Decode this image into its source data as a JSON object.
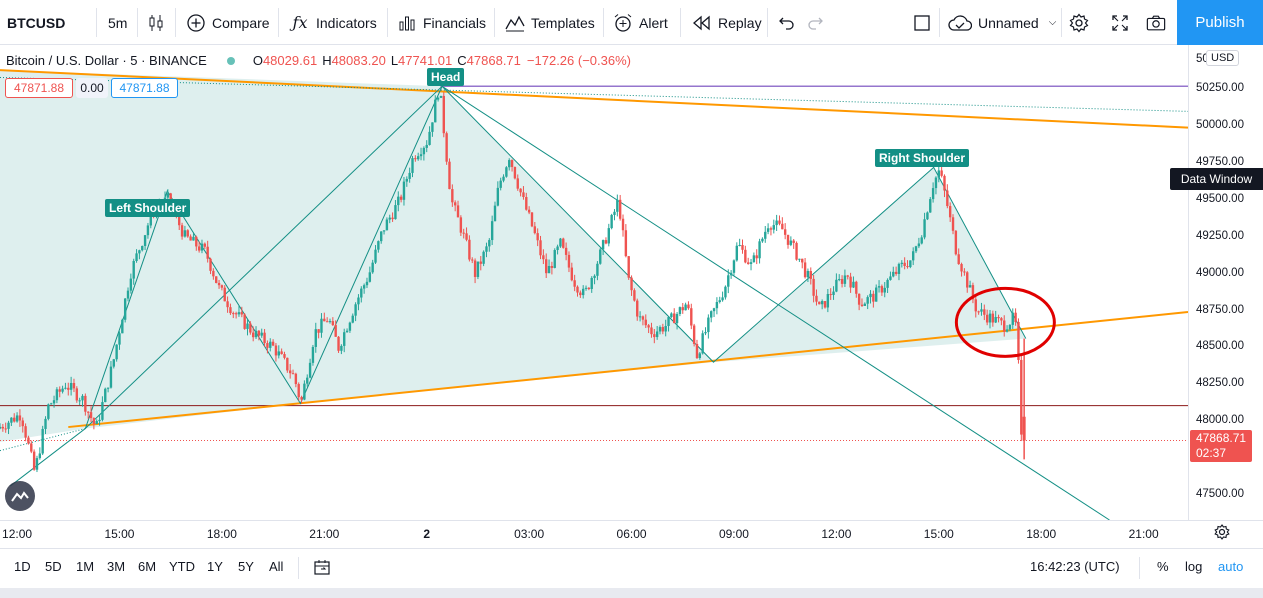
{
  "toolbar": {
    "symbol": "BTCUSD",
    "interval": "5m",
    "compare": "Compare",
    "indicators": "Indicators",
    "financials": "Financials",
    "templates": "Templates",
    "alert": "Alert",
    "replay": "Replay",
    "layout_name": "Unnamed",
    "publish": "Publish"
  },
  "legend": {
    "symbol_title": "Bitcoin / U.S. Dollar · 5 · BINANCE",
    "o_label": "O",
    "open": "48029.61",
    "h_label": "H",
    "high": "48083.20",
    "l_label": "L",
    "low": "47741.01",
    "c_label": "C",
    "close": "47868.71",
    "change": "−172.26 (−0.36%)"
  },
  "order_boxes": {
    "bid": "47871.88",
    "spread": "0.00",
    "ask": "47871.88"
  },
  "pattern_labels": {
    "left_shoulder": "Left Shoulder",
    "head": "Head",
    "right_shoulder": "Right Shoulder"
  },
  "price_axis": {
    "currency": "USD",
    "top_cut": "50...00",
    "data_window": "Data Window",
    "last_price": "47868.71",
    "countdown": "02:37"
  },
  "bottom_bar": {
    "ranges": [
      "1D",
      "5D",
      "1M",
      "3M",
      "6M",
      "YTD",
      "1Y",
      "5Y",
      "All"
    ],
    "clock": "16:42:23 (UTC)",
    "percent": "%",
    "log": "log",
    "auto": "auto"
  },
  "colors": {
    "up": "#26a69a",
    "down": "#ef5350",
    "pattern": "#138f85",
    "trendline": "#ff9800",
    "accent": "#2196f3",
    "highlight_circle": "#e00000"
  },
  "chart_data": {
    "type": "candlestick",
    "symbol": "BTCUSD",
    "interval": "5",
    "exchange": "BINANCE",
    "y_ticks": [
      50250,
      50000,
      49750,
      49500,
      49250,
      49000,
      48750,
      48500,
      48250,
      48000,
      47500
    ],
    "y_tick_labels": [
      "50250.00",
      "50000.00",
      "49750.00",
      "49500.00",
      "49250.00",
      "49000.00",
      "48750.00",
      "48500.00",
      "48250.00",
      "48000.00",
      "47500.00"
    ],
    "ylim": [
      47330,
      50550
    ],
    "x_tick_labels": [
      "12:00",
      "15:00",
      "18:00",
      "21:00",
      "2",
      "03:00",
      "06:00",
      "09:00",
      "12:00",
      "15:00",
      "18:00",
      "21:00"
    ],
    "x_ticks_hours": [
      12,
      15,
      18,
      21,
      24,
      27,
      30,
      33,
      36,
      39,
      42,
      45
    ],
    "xlim_hours": [
      11.5,
      46.3
    ],
    "price_path": [
      [
        11.5,
        47950
      ],
      [
        12.2,
        48050
      ],
      [
        12.6,
        47650
      ],
      [
        13.0,
        48100
      ],
      [
        13.5,
        48250
      ],
      [
        14.0,
        48150
      ],
      [
        14.4,
        47950
      ],
      [
        14.9,
        48400
      ],
      [
        15.4,
        49000
      ],
      [
        16.1,
        49450
      ],
      [
        16.5,
        49500
      ],
      [
        17.0,
        49250
      ],
      [
        17.6,
        49150
      ],
      [
        18.0,
        48900
      ],
      [
        18.4,
        48750
      ],
      [
        19.0,
        48600
      ],
      [
        19.6,
        48500
      ],
      [
        20.2,
        48300
      ],
      [
        20.4,
        48120
      ],
      [
        20.8,
        48600
      ],
      [
        21.2,
        48700
      ],
      [
        21.5,
        48500
      ],
      [
        22.0,
        48800
      ],
      [
        22.4,
        49000
      ],
      [
        22.8,
        49300
      ],
      [
        23.3,
        49500
      ],
      [
        23.7,
        49800
      ],
      [
        24.1,
        49900
      ],
      [
        24.45,
        50270
      ],
      [
        24.8,
        49500
      ],
      [
        25.1,
        49300
      ],
      [
        25.5,
        49000
      ],
      [
        25.9,
        49200
      ],
      [
        26.2,
        49600
      ],
      [
        26.5,
        49800
      ],
      [
        26.9,
        49500
      ],
      [
        27.2,
        49300
      ],
      [
        27.6,
        49000
      ],
      [
        28.0,
        49200
      ],
      [
        28.4,
        48950
      ],
      [
        28.7,
        48850
      ],
      [
        29.2,
        49150
      ],
      [
        29.7,
        49500
      ],
      [
        30.0,
        48950
      ],
      [
        30.3,
        48700
      ],
      [
        30.7,
        48600
      ],
      [
        31.1,
        48650
      ],
      [
        31.7,
        48800
      ],
      [
        32.0,
        48450
      ],
      [
        32.4,
        48700
      ],
      [
        32.8,
        48900
      ],
      [
        33.2,
        49200
      ],
      [
        33.6,
        49050
      ],
      [
        34.1,
        49350
      ],
      [
        34.5,
        49300
      ],
      [
        35.0,
        49100
      ],
      [
        35.3,
        48950
      ],
      [
        35.6,
        48750
      ],
      [
        36.0,
        48900
      ],
      [
        36.4,
        49000
      ],
      [
        36.8,
        48800
      ],
      [
        37.2,
        48850
      ],
      [
        37.6,
        48950
      ],
      [
        38.0,
        49050
      ],
      [
        38.3,
        49100
      ],
      [
        38.6,
        49300
      ],
      [
        38.9,
        49600
      ],
      [
        39.1,
        49700
      ],
      [
        39.3,
        49500
      ],
      [
        39.6,
        49150
      ],
      [
        39.9,
        48950
      ],
      [
        40.2,
        48750
      ],
      [
        40.6,
        48700
      ],
      [
        41.0,
        48650
      ],
      [
        41.3,
        48700
      ],
      [
        41.4,
        48550
      ],
      [
        41.45,
        48030
      ],
      [
        41.5,
        47870
      ]
    ],
    "annotations": [
      "Left Shoulder",
      "Head",
      "Right Shoulder"
    ],
    "last_price": 47868.71
  }
}
